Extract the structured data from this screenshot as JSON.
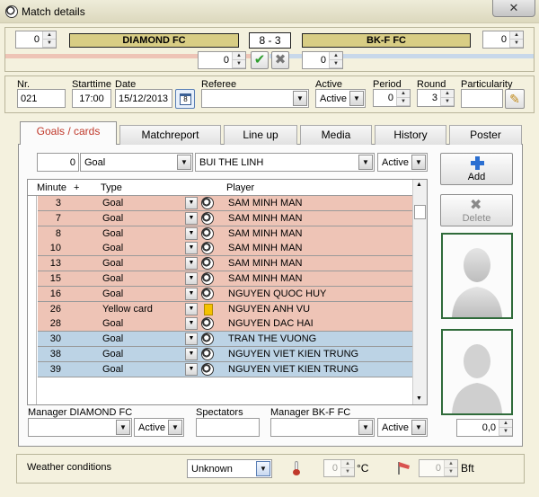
{
  "window": {
    "title": "Match details"
  },
  "header": {
    "home_points": "0",
    "home_team": "DIAMOND FC",
    "score": "8  - 3",
    "away_team": "BK-F FC",
    "away_points": "0",
    "home_sub": "0",
    "away_sub": "0"
  },
  "info": {
    "nr_label": "Nr.",
    "nr": "021",
    "starttime_label": "Starttime",
    "starttime": "17:00",
    "date_label": "Date",
    "date": "15/12/2013",
    "referee_label": "Referee",
    "referee": "",
    "active_label": "Active",
    "active": "Active",
    "period_label": "Period",
    "period": "0",
    "round_label": "Round",
    "round": "3",
    "particularity_label": "Particularity",
    "particularity": ""
  },
  "tabs": [
    "Goals / cards",
    "Matchreport",
    "Line up",
    "Media",
    "History",
    "Poster"
  ],
  "entry": {
    "minute": "0",
    "type": "Goal",
    "player": "BUI THE LINH",
    "status": "Active"
  },
  "table": {
    "headers": {
      "minute": "Minute",
      "plus": "+",
      "type": "Type",
      "player": "Player"
    },
    "rows": [
      {
        "minute": "3",
        "type": "Goal",
        "player": "SAM MINH MAN",
        "team": "home",
        "icon": "ball"
      },
      {
        "minute": "7",
        "type": "Goal",
        "player": "SAM MINH MAN",
        "team": "home",
        "icon": "ball"
      },
      {
        "minute": "8",
        "type": "Goal",
        "player": "SAM MINH MAN",
        "team": "home",
        "icon": "ball"
      },
      {
        "minute": "10",
        "type": "Goal",
        "player": "SAM MINH MAN",
        "team": "home",
        "icon": "ball"
      },
      {
        "minute": "13",
        "type": "Goal",
        "player": "SAM MINH MAN",
        "team": "home",
        "icon": "ball"
      },
      {
        "minute": "15",
        "type": "Goal",
        "player": "SAM MINH MAN",
        "team": "home",
        "icon": "ball"
      },
      {
        "minute": "16",
        "type": "Goal",
        "player": "NGUYEN QUOC HUY",
        "team": "home",
        "icon": "ball"
      },
      {
        "minute": "26",
        "type": "Yellow card",
        "player": "NGUYEN ANH VU",
        "team": "home",
        "icon": "yellow-card"
      },
      {
        "minute": "28",
        "type": "Goal",
        "player": "NGUYEN DAC HAI",
        "team": "home",
        "icon": "ball"
      },
      {
        "minute": "30",
        "type": "Goal",
        "player": "TRAN THE VUONG",
        "team": "away",
        "icon": "ball"
      },
      {
        "minute": "38",
        "type": "Goal",
        "player": "NGUYEN VIET KIEN TRUNG",
        "team": "away",
        "icon": "ball"
      },
      {
        "minute": "39",
        "type": "Goal",
        "player": "NGUYEN VIET KIEN TRUNG",
        "team": "away",
        "icon": "ball"
      }
    ]
  },
  "buttons": {
    "add": "Add",
    "delete": "Delete"
  },
  "bottom": {
    "manager_home_label": "Manager DIAMOND FC",
    "manager_home": "",
    "manager_home_status": "Active",
    "spectators_label": "Spectators",
    "spectators": "",
    "manager_away_label": "Manager BK-F FC",
    "manager_away": "",
    "manager_away_status": "Active",
    "rating": "0,0"
  },
  "weather": {
    "label": "Weather conditions",
    "value": "Unknown",
    "temp": "0",
    "temp_unit": "°C",
    "wind": "0",
    "wind_unit": "Bft"
  },
  "colors": {
    "home_row": "#eec4b6",
    "away_row": "#bcd3e5",
    "team_bar": "#d8cd84",
    "accent": "#c0392b"
  }
}
